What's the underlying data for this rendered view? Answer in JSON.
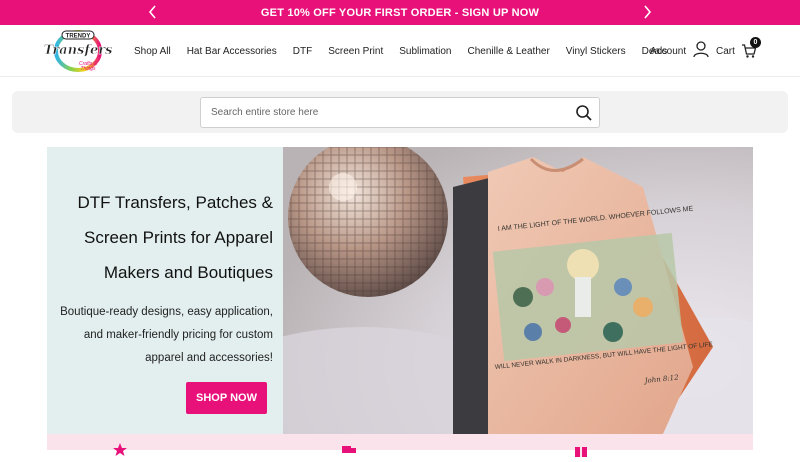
{
  "promo": {
    "text": "GET 10% OFF YOUR FIRST ORDER - SIGN UP NOW",
    "prev_icon": "chevron-left-icon",
    "next_icon": "chevron-right-icon"
  },
  "header": {
    "logo_text": "Trendy Transfers",
    "nav": [
      "Shop All",
      "Hat Bar Accessories",
      "DTF",
      "Screen Print",
      "Sublimation",
      "Chenille & Leather",
      "Vinyl Stickers",
      "Deals"
    ],
    "account_label": "Account",
    "cart_label": "Cart",
    "cart_count": "0"
  },
  "search": {
    "placeholder": "Search entire store here",
    "value": ""
  },
  "hero": {
    "title": "DTF Transfers, Patches & Screen Prints for Apparel Makers and Boutiques",
    "subtitle": "Boutique-ready designs, easy application, and maker-friendly pricing for custom apparel and accessories!",
    "button_label": "SHOP NOW",
    "shirt_text_top": "I AM THE LIGHT OF THE WORLD. WHOEVER FOLLOWS ME",
    "shirt_text_bottom": "WILL NEVER WALK IN DARKNESS, BUT WILL HAVE THE LIGHT OF LIFE",
    "shirt_verse": "John 8:12"
  },
  "colors": {
    "accent": "#e8117a",
    "hero_panel": "#e3efef",
    "feature_strip": "#fbe3ec"
  }
}
